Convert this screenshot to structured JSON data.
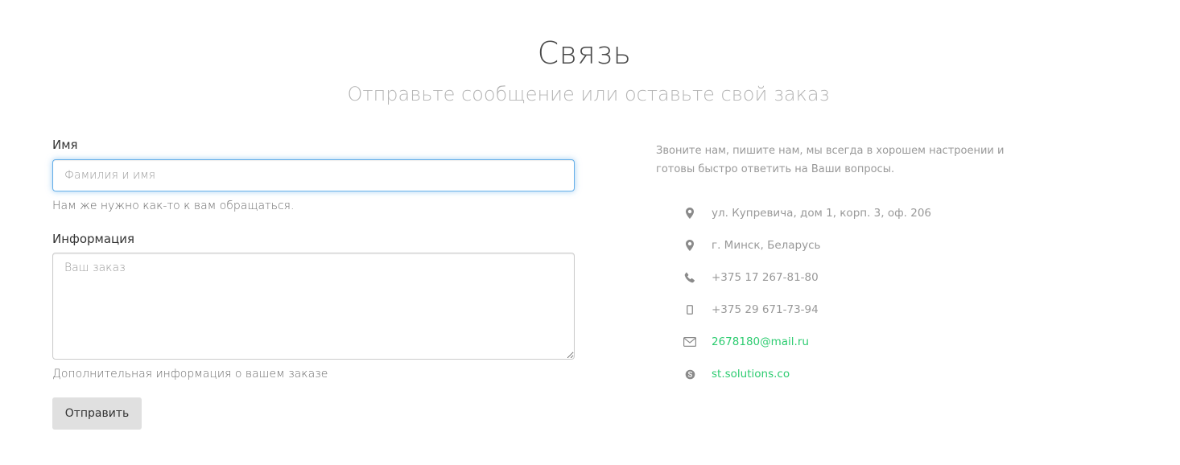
{
  "header": {
    "title": "Связь",
    "subtitle": "Отправьте сообщение или оставьте свой заказ"
  },
  "form": {
    "name_label": "Имя",
    "name_placeholder": "Фамилия и имя",
    "name_value": "",
    "name_help": "Нам же нужно как-то к вам обращаться.",
    "info_label": "Информация",
    "info_placeholder": "Ваш заказ",
    "info_value": "",
    "info_help": "Дополнительная информация о вашем заказе",
    "submit_label": "Отправить"
  },
  "contacts": {
    "intro": "Звоните нам, пишите нам, мы всегда в хорошем настроении и готовы быстро ответить на Ваши вопросы.",
    "items": [
      {
        "icon": "map-marker-icon",
        "text": "ул. Купревича, дом 1, корп. 3, оф. 206"
      },
      {
        "icon": "map-marker-icon",
        "text": "г. Минск, Беларусь"
      },
      {
        "icon": "phone-icon",
        "text": "+375 17 267-81-80"
      },
      {
        "icon": "mobile-icon",
        "text": "+375 29 671-73-94"
      },
      {
        "icon": "envelope-icon",
        "text": "2678180@mail.ru"
      },
      {
        "icon": "skype-icon",
        "text": "st.solutions.co"
      }
    ]
  },
  "colors": {
    "link": "#2ecc71",
    "focus_border": "#66afe9",
    "button_bg": "#e0e0e0",
    "muted_text": "#999999"
  }
}
